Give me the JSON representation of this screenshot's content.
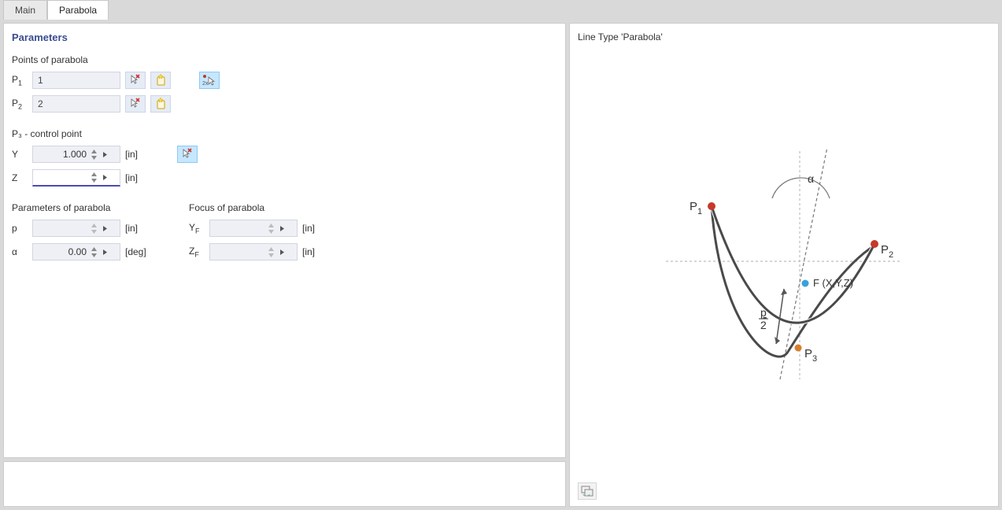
{
  "tabs": {
    "main": "Main",
    "parabola": "Parabola"
  },
  "section_title": "Parameters",
  "points_label": "Points of parabola",
  "p1": {
    "label": "P",
    "sub": "1",
    "value": "1"
  },
  "p2": {
    "label": "P",
    "sub": "2",
    "value": "2"
  },
  "control_label": "P₃ - control point",
  "cp_y": {
    "label": "Y",
    "value": "1.000",
    "unit": "[in]"
  },
  "cp_z": {
    "label": "Z",
    "value": "",
    "unit": "[in]"
  },
  "param_of_parabola": "Parameters of parabola",
  "pp_p": {
    "label": "p",
    "value": "",
    "unit": "[in]"
  },
  "pp_a": {
    "label": "α",
    "value": "0.00",
    "unit": "[deg]"
  },
  "focus_label": "Focus of parabola",
  "fp_y": {
    "label": "Y",
    "sub": "F",
    "value": "",
    "unit": "[in]"
  },
  "fp_z": {
    "label": "Z",
    "sub": "F",
    "value": "",
    "unit": "[in]"
  },
  "preview_title": "Line Type 'Parabola'",
  "diagram": {
    "p1": "P",
    "p1s": "1",
    "p2": "P",
    "p2s": "2",
    "p3": "P",
    "p3s": "3",
    "f": "F (X,Y,Z)",
    "alpha": "α",
    "p": "p",
    "two": "2"
  }
}
